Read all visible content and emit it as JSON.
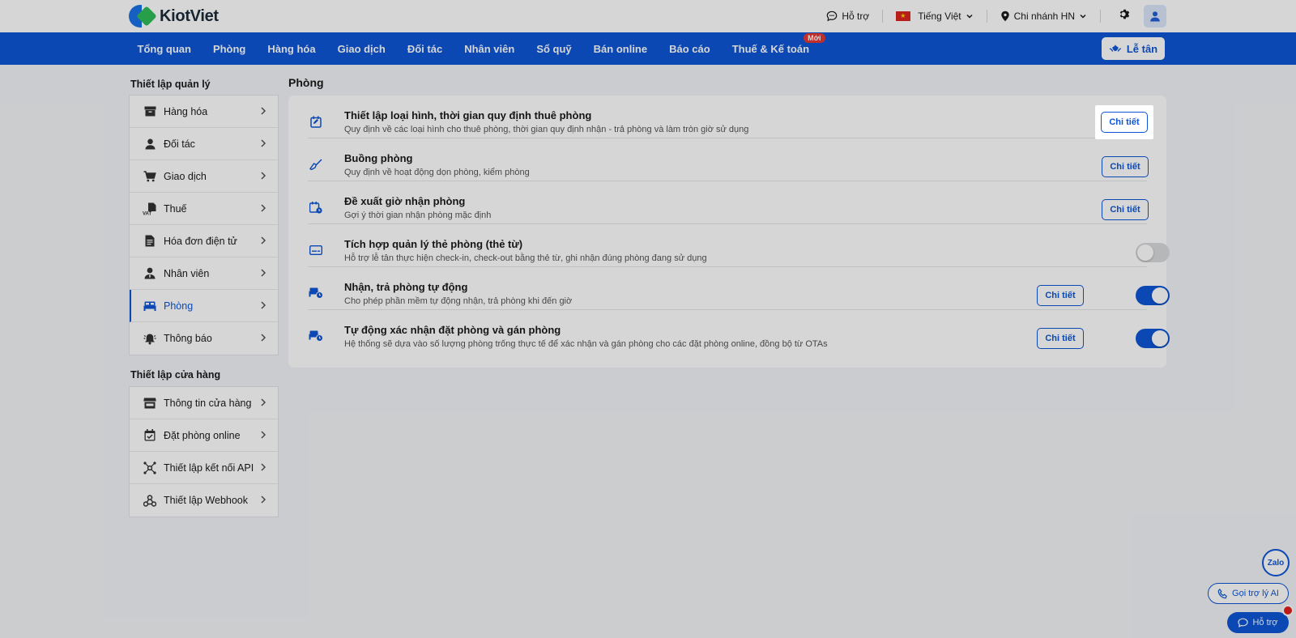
{
  "brand": {
    "name": "KiotViet",
    "icon": "kiotviet-logo"
  },
  "topbar": {
    "support_label": "Hỗ trợ",
    "language_label": "Tiếng Việt",
    "branch_label": "Chi nhánh HN"
  },
  "nav": {
    "items": [
      "Tổng quan",
      "Phòng",
      "Hàng hóa",
      "Giao dịch",
      "Đối tác",
      "Nhân viên",
      "Sổ quỹ",
      "Bán online",
      "Báo cáo",
      "Thuế & Kế toán"
    ],
    "new_badge": "Mới",
    "reception_label": "Lễ tân"
  },
  "sidebar": {
    "management_heading": "Thiết lập quản lý",
    "management_items": [
      {
        "label": "Hàng hóa",
        "icon": "box-icon"
      },
      {
        "label": "Đối tác",
        "icon": "person-icon"
      },
      {
        "label": "Giao dịch",
        "icon": "cart-icon"
      },
      {
        "label": "Thuế",
        "icon": "vat-icon"
      },
      {
        "label": "Hóa đơn điện tử",
        "icon": "invoice-icon"
      },
      {
        "label": "Nhân viên",
        "icon": "staff-icon"
      },
      {
        "label": "Phòng",
        "icon": "bed-icon",
        "active": true
      },
      {
        "label": "Thông báo",
        "icon": "bell-icon"
      }
    ],
    "store_heading": "Thiết lập cửa hàng",
    "store_items": [
      {
        "label": "Thông tin cửa hàng",
        "icon": "store-icon"
      },
      {
        "label": "Đặt phòng online",
        "icon": "calendar-check-icon"
      },
      {
        "label": "Thiết lập kết nối API",
        "icon": "api-icon"
      },
      {
        "label": "Thiết lập Webhook",
        "icon": "webhook-icon"
      }
    ]
  },
  "main": {
    "title": "Phòng",
    "detail_label": "Chi tiết",
    "rows": [
      {
        "title": "Thiết lập loại hình, thời gian quy định thuê phòng",
        "desc": "Quy định về các loại hình cho thuê phòng, thời gian quy định nhận - trả phòng và làm tròn giờ sử dụng",
        "icon": "calendar-edit-icon",
        "has_detail": true,
        "toggle": null
      },
      {
        "title": "Buồng phòng",
        "desc": "Quy định về hoạt động dọn phòng, kiểm phòng",
        "icon": "broom-icon",
        "has_detail": true,
        "toggle": null
      },
      {
        "title": "Đề xuất giờ nhận phòng",
        "desc": "Gợi ý thời gian nhận phòng mặc định",
        "icon": "calendar-clock-icon",
        "has_detail": true,
        "toggle": null
      },
      {
        "title": "Tích hợp quản lý thẻ phòng (thẻ từ)",
        "desc": "Hỗ trợ lễ tân thực hiện check-in, check-out bằng thẻ từ, ghi nhận đúng phòng đang sử dụng",
        "icon": "keycard-icon",
        "has_detail": false,
        "toggle": "off"
      },
      {
        "title": "Nhận, trả phòng tự động",
        "desc": "Cho phép phần mềm tự động nhận, trả phòng khi đến giờ",
        "icon": "bed-auto-icon",
        "has_detail": true,
        "toggle": "on"
      },
      {
        "title": "Tự động xác nhận đặt phòng và gán phòng",
        "desc": "Hệ thống sẽ dựa vào số lượng phòng trống thực tế để xác nhận và gán phòng cho các đặt phòng online, đồng bộ từ OTAs",
        "icon": "bed-auto-icon",
        "has_detail": true,
        "toggle": "on"
      }
    ]
  },
  "widgets": {
    "zalo_label": "Zalo",
    "ai_label": "Gọi trợ lý AI",
    "help_label": "Hỗ trợ"
  },
  "colors": {
    "primary": "#0e56d6",
    "danger": "#e53935",
    "toggle_off": "#d8dadd"
  }
}
